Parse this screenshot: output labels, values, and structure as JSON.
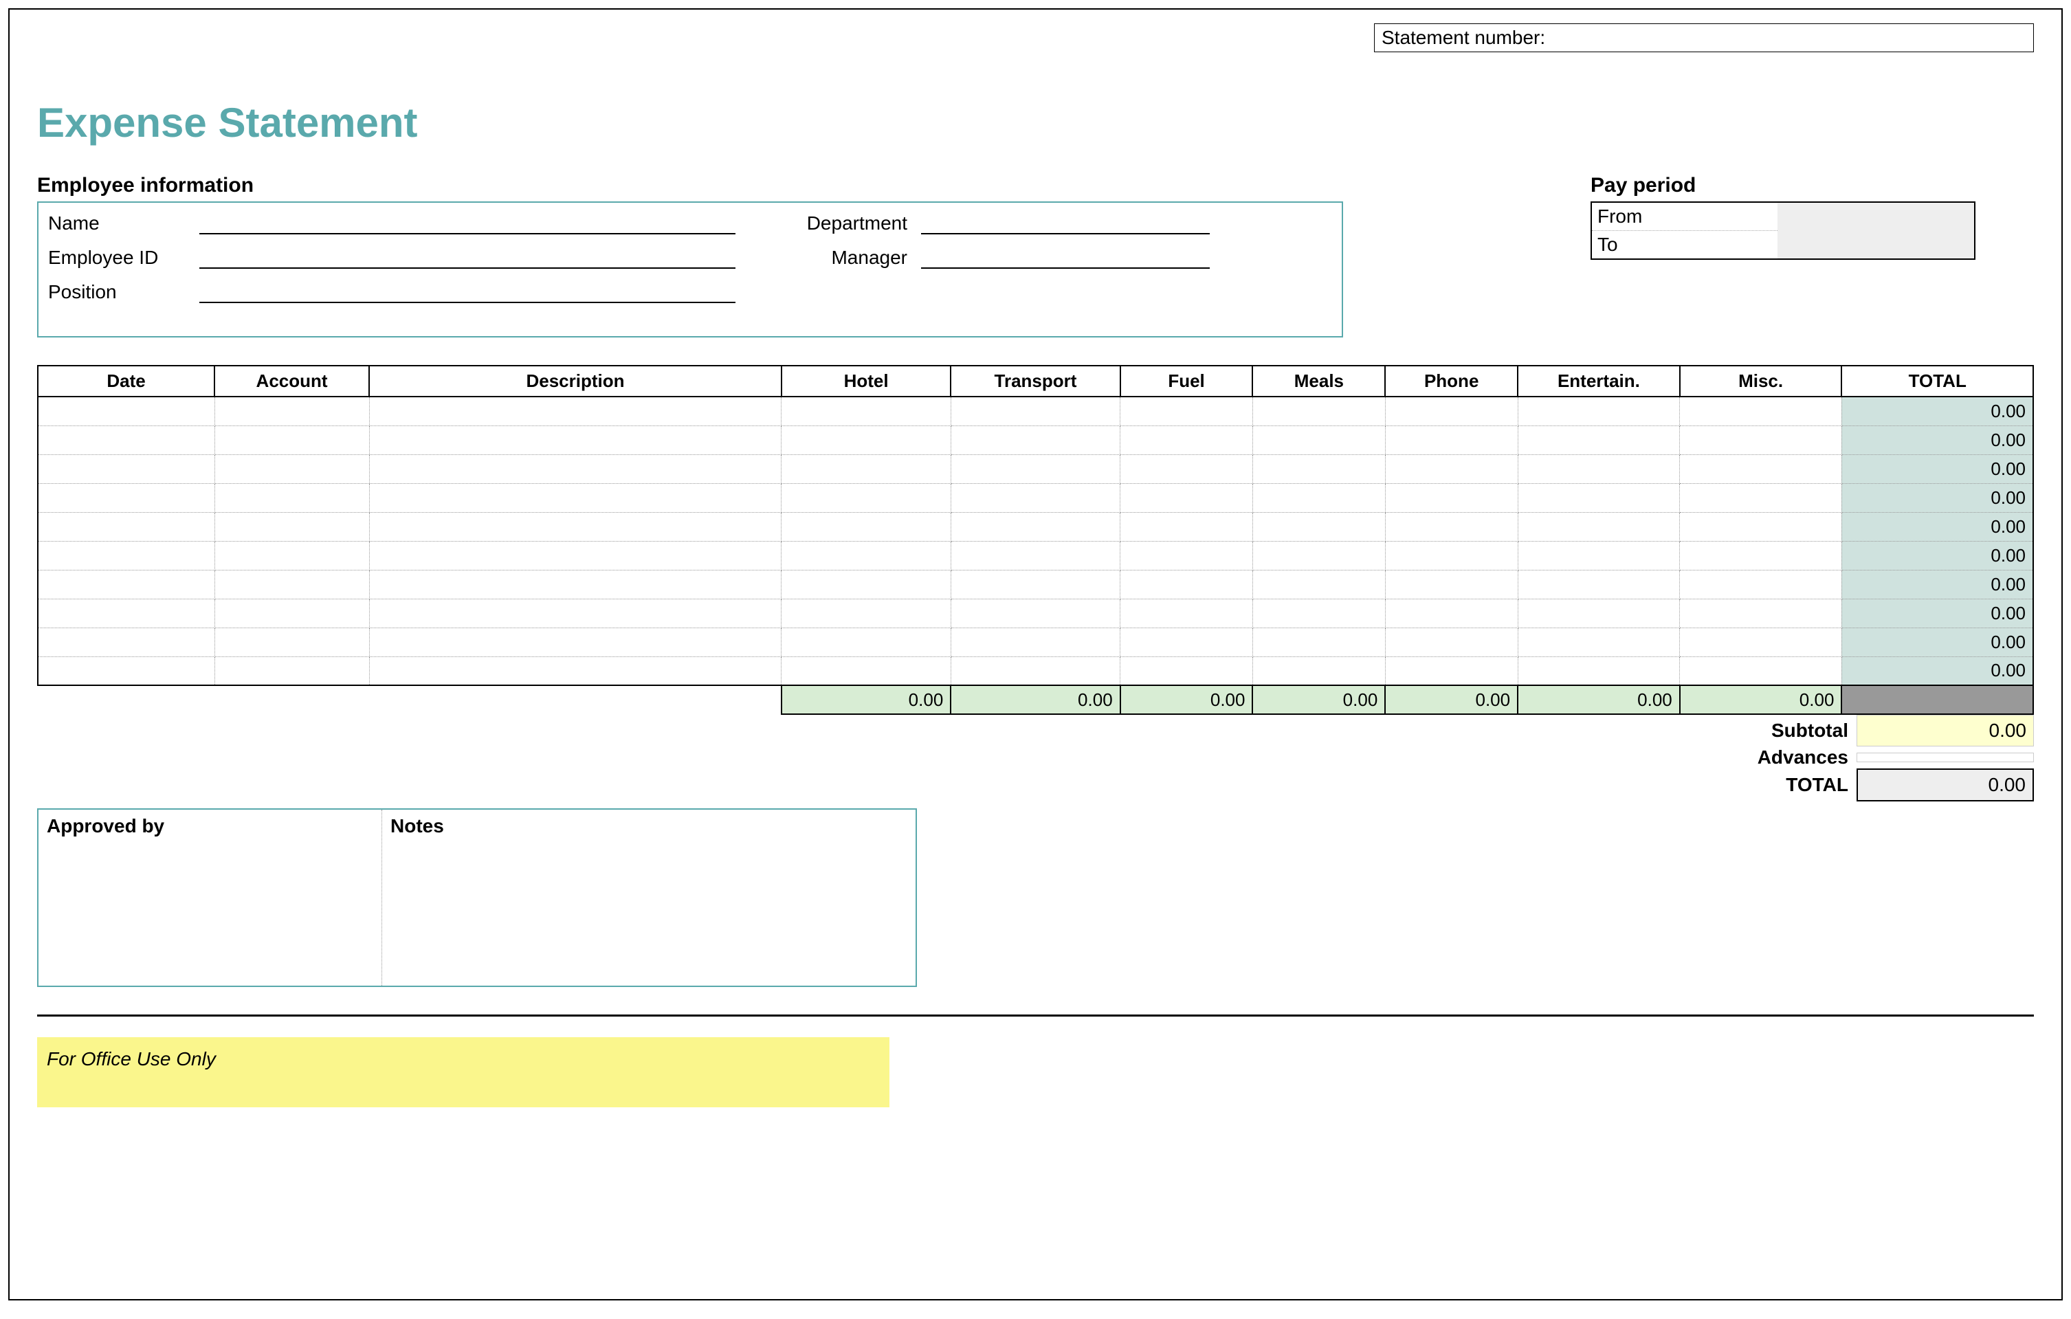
{
  "statement_number_label": "Statement number:",
  "statement_number_value": "",
  "title": "Expense Statement",
  "sections": {
    "employee_info_header": "Employee information",
    "pay_period_header": "Pay period"
  },
  "employee": {
    "name_label": "Name",
    "name_value": "",
    "department_label": "Department",
    "department_value": "",
    "id_label": "Employee ID",
    "id_value": "",
    "manager_label": "Manager",
    "manager_value": "",
    "position_label": "Position",
    "position_value": ""
  },
  "pay_period": {
    "from_label": "From",
    "from_value": "",
    "to_label": "To",
    "to_value": ""
  },
  "columns": {
    "date": "Date",
    "account": "Account",
    "description": "Description",
    "hotel": "Hotel",
    "transport": "Transport",
    "fuel": "Fuel",
    "meals": "Meals",
    "phone": "Phone",
    "entertain": "Entertain.",
    "misc": "Misc.",
    "total": "TOTAL"
  },
  "rows": [
    {
      "total": "0.00"
    },
    {
      "total": "0.00"
    },
    {
      "total": "0.00"
    },
    {
      "total": "0.00"
    },
    {
      "total": "0.00"
    },
    {
      "total": "0.00"
    },
    {
      "total": "0.00"
    },
    {
      "total": "0.00"
    },
    {
      "total": "0.00"
    },
    {
      "total": "0.00"
    }
  ],
  "col_sums": {
    "hotel": "0.00",
    "transport": "0.00",
    "fuel": "0.00",
    "meals": "0.00",
    "phone": "0.00",
    "entertain": "0.00",
    "misc": "0.00"
  },
  "summary": {
    "subtotal_label": "Subtotal",
    "subtotal_value": "0.00",
    "advances_label": "Advances",
    "advances_value": "",
    "total_label": "TOTAL",
    "total_value": "0.00"
  },
  "approval": {
    "approved_by_label": "Approved by",
    "notes_label": "Notes"
  },
  "office_use_label": "For Office Use Only"
}
